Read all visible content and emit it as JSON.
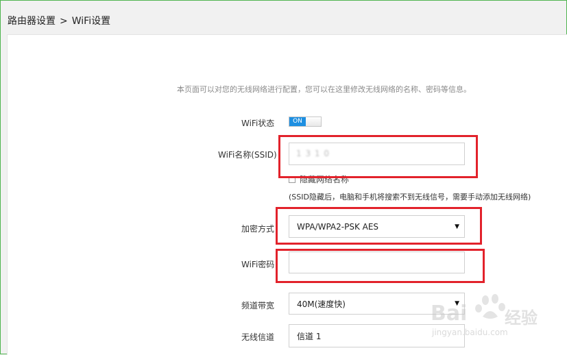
{
  "breadcrumb": {
    "parent": "路由器设置",
    "separator": ">",
    "current": "WiFi设置"
  },
  "intro": "本页面可以对您的无线网络进行配置，您可以在这里修改无线网络的名称、密码等信息。",
  "wifi_status": {
    "label": "WiFi状态",
    "toggle_text": "ON",
    "on": true
  },
  "ssid": {
    "label": "WiFi名称(SSID)",
    "value": "1 3 1 0"
  },
  "hide_ssid": {
    "label": "隐藏网络名称",
    "checked": false,
    "hint": "(SSID隐藏后，电脑和手机将搜索不到无线信号，需要手动添加无线网络)"
  },
  "encryption": {
    "label": "加密方式",
    "selected": "WPA/WPA2-PSK AES"
  },
  "password": {
    "label": "WiFi密码",
    "value": ""
  },
  "bandwidth": {
    "label": "频道带宽",
    "selected": "40M(速度快)"
  },
  "channel": {
    "label": "无线信道",
    "selected": "信道 1"
  },
  "watermark": {
    "brand": "Bai",
    "brand_suffix": "经验",
    "url": "jingyan.baidu.com"
  },
  "colors": {
    "toggle_on": "#1e8fe1",
    "highlight_box": "#e2222b",
    "frame_border": "#4fb54f"
  }
}
